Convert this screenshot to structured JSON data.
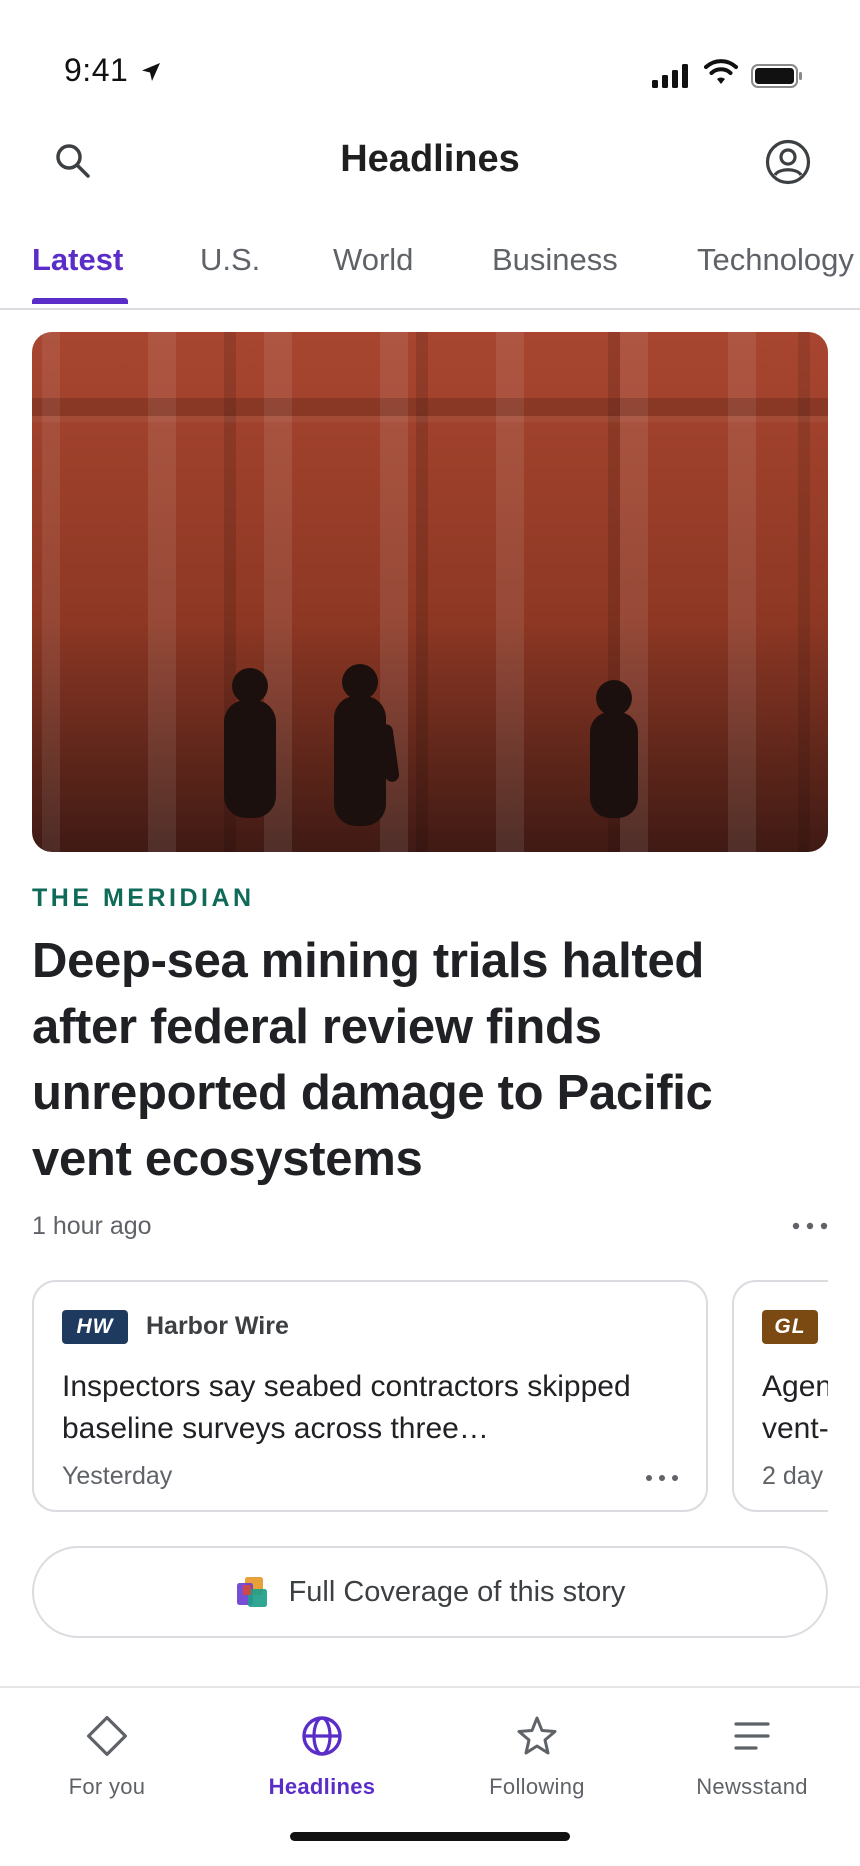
{
  "status_bar": {
    "time": "9:41"
  },
  "header": {
    "title": "Headlines"
  },
  "tabs": [
    {
      "label": "Latest",
      "active": true
    },
    {
      "label": "U.S.",
      "active": false
    },
    {
      "label": "World",
      "active": false
    },
    {
      "label": "Business",
      "active": false
    },
    {
      "label": "Technology",
      "active": false
    }
  ],
  "lead_story": {
    "source": "THE MERIDIAN",
    "headline": "Deep-sea mining trials halted after federal review finds unreported damage to Pacific vent ecosystems",
    "time": "1 hour ago"
  },
  "related": [
    {
      "badge": "HW",
      "badge_color": "#1f3a5f",
      "source": "Harbor Wire",
      "title": "Inspectors say seabed contractors skipped baseline surveys across three…",
      "time": "Yesterday"
    },
    {
      "badge": "GL",
      "badge_color": "#7a4a12",
      "source": "",
      "title": "Agen vent-",
      "title_line1": "Agen",
      "title_line2": "vent-",
      "time": "2 day"
    }
  ],
  "full_coverage": {
    "label": "Full Coverage of this story"
  },
  "bottom_nav": [
    {
      "label": "For you",
      "icon": "diamond-icon",
      "active": false
    },
    {
      "label": "Headlines",
      "icon": "globe-icon",
      "active": true
    },
    {
      "label": "Following",
      "icon": "star-icon",
      "active": false
    },
    {
      "label": "Newsstand",
      "icon": "menu-lines-icon",
      "active": false
    }
  ],
  "colors": {
    "accent": "#5b2dc8",
    "source_label": "#0f6b58",
    "hero_base": "#a8452e"
  }
}
